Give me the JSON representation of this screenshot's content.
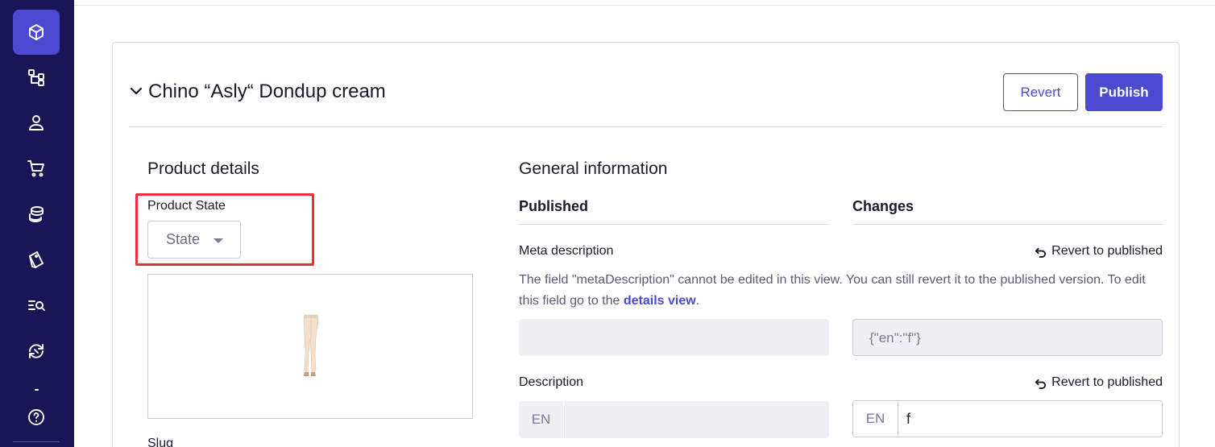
{
  "sidebar": {
    "items": [
      {
        "icon": "box-icon",
        "active": true
      },
      {
        "icon": "hierarchy-icon"
      },
      {
        "icon": "user-icon"
      },
      {
        "icon": "cart-icon"
      },
      {
        "icon": "coins-icon"
      },
      {
        "icon": "tag-icon"
      },
      {
        "icon": "search-list-icon"
      },
      {
        "icon": "sync-icon"
      },
      {
        "icon": "help-icon"
      }
    ],
    "active_color": "#4b4ad1",
    "background": "#1a1554"
  },
  "product": {
    "title": "Chino “Asly“ Dondup cream"
  },
  "actions": {
    "revert_label": "Revert",
    "publish_label": "Publish"
  },
  "product_details": {
    "heading": "Product details",
    "state_label": "Product State",
    "state_placeholder": "State",
    "slug_label": "Slug"
  },
  "general_info": {
    "heading": "General information",
    "published_heading": "Published",
    "changes_heading": "Changes",
    "meta_description": {
      "label": "Meta description",
      "revert_label": "Revert to published",
      "info_prefix": "The field \"metaDescription\" cannot be edited in this view. You can still revert it to the published version. To edit this field go to the ",
      "info_link": "details view",
      "info_suffix": ".",
      "published_value": "",
      "changes_value": "{\"en\":\"f\"}"
    },
    "description": {
      "label": "Description",
      "revert_label": "Revert to published",
      "published_lang": "EN",
      "published_value": "",
      "changes_lang": "EN",
      "changes_value": "f"
    }
  },
  "colors": {
    "accent": "#4b4ad1",
    "highlight": "#e8303c"
  }
}
